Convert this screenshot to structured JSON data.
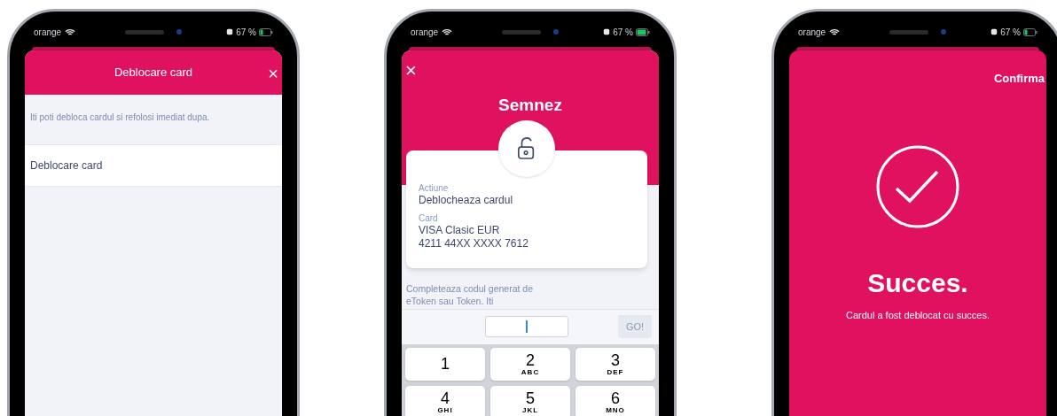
{
  "phones": [
    {
      "status_bar": {
        "carrier": "orange",
        "battery": "67 %"
      },
      "screen": {
        "kind": "list",
        "title": "Deblocare card",
        "close": "×",
        "description": "Iti poti debloca cardul si refolosi imediat dupa.",
        "items": [
          {
            "label": "Deblocare card"
          }
        ]
      }
    },
    {
      "status_bar": {
        "carrier": "orange",
        "battery": "67 %"
      },
      "screen": {
        "kind": "sign",
        "close": "×",
        "title": "Semnez",
        "fields": [
          {
            "label": "Actiune",
            "lines": [
              "Deblocheaza cardul"
            ]
          },
          {
            "label": "Card",
            "lines": [
              "VISA Clasic EUR",
              "4211 44XX XXXX 7612"
            ]
          }
        ],
        "instructions": "Completeaza codul generat de eToken sau Token. Iti",
        "code_field": {
          "cursor": true
        },
        "go_button": {
          "label": "GO!",
          "disabled": true
        },
        "keys": [
          {
            "digit": "1"
          },
          {
            "digit": "2",
            "letters": "ABC"
          },
          {
            "digit": "3",
            "letters": "DEF"
          },
          {
            "digit": "4",
            "letters": "GHI"
          },
          {
            "digit": "5",
            "letters": "JKL"
          },
          {
            "digit": "6",
            "letters": "MNO"
          }
        ]
      }
    },
    {
      "status_bar": {
        "carrier": "orange",
        "battery": "67 %"
      },
      "screen": {
        "kind": "success",
        "confirm": "Confirma",
        "title": "Succes.",
        "message": "Cardul a fost deblocat cu succes."
      }
    }
  ]
}
